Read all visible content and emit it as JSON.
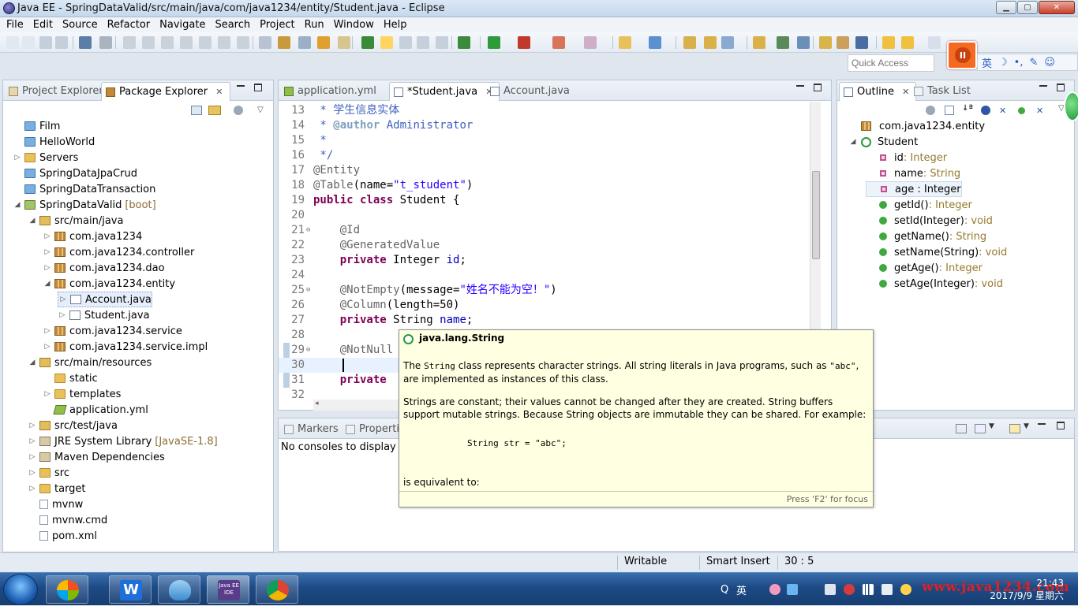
{
  "window": {
    "title": "Java EE - SpringDataValid/src/main/java/com/java1234/entity/Student.java - Eclipse",
    "min_glyph": "▁",
    "max_glyph": "▢",
    "close_glyph": "✕"
  },
  "menu": [
    "File",
    "Edit",
    "Source",
    "Refactor",
    "Navigate",
    "Search",
    "Project",
    "Run",
    "Window",
    "Help"
  ],
  "toolbar": {
    "quick_access_placeholder": "Quick Access",
    "ime_bar": [
      "英",
      "☽",
      "•,",
      "✎",
      "☺"
    ],
    "pause_glyph": "II"
  },
  "package_explorer": {
    "tabs": [
      "Project Explorer",
      "Package Explorer"
    ],
    "close_glyph": "✕",
    "tree": [
      {
        "label": "Film",
        "icon": "project",
        "arrow": "",
        "indent": 0
      },
      {
        "label": "HelloWorld",
        "icon": "project",
        "arrow": "",
        "indent": 0
      },
      {
        "label": "Servers",
        "icon": "folder",
        "arrow": "▷",
        "indent": 0
      },
      {
        "label": "SpringDataJpaCrud",
        "icon": "project",
        "arrow": "",
        "indent": 0
      },
      {
        "label": "SpringDataTransaction",
        "icon": "project",
        "arrow": "",
        "indent": 0
      },
      {
        "label": "SpringDataValid",
        "icon": "project-open",
        "arrow": "◢",
        "indent": 0,
        "decor": "[boot]"
      },
      {
        "label": "src/main/java",
        "icon": "srcfolder",
        "arrow": "◢",
        "indent": 1
      },
      {
        "label": "com.java1234",
        "icon": "package",
        "arrow": "▷",
        "indent": 2
      },
      {
        "label": "com.java1234.controller",
        "icon": "package",
        "arrow": "▷",
        "indent": 2
      },
      {
        "label": "com.java1234.dao",
        "icon": "package",
        "arrow": "▷",
        "indent": 2
      },
      {
        "label": "com.java1234.entity",
        "icon": "package",
        "arrow": "◢",
        "indent": 2
      },
      {
        "label": "Account.java",
        "icon": "java",
        "arrow": "▷",
        "indent": 3,
        "selected": true
      },
      {
        "label": "Student.java",
        "icon": "java",
        "arrow": "▷",
        "indent": 3
      },
      {
        "label": "com.java1234.service",
        "icon": "package",
        "arrow": "▷",
        "indent": 2
      },
      {
        "label": "com.java1234.service.impl",
        "icon": "package",
        "arrow": "▷",
        "indent": 2
      },
      {
        "label": "src/main/resources",
        "icon": "srcfolder",
        "arrow": "◢",
        "indent": 1
      },
      {
        "label": "static",
        "icon": "folder",
        "arrow": "",
        "indent": 2
      },
      {
        "label": "templates",
        "icon": "folder",
        "arrow": "▷",
        "indent": 2
      },
      {
        "label": "application.yml",
        "icon": "yml",
        "arrow": "",
        "indent": 2
      },
      {
        "label": "src/test/java",
        "icon": "srcfolder",
        "arrow": "▷",
        "indent": 1
      },
      {
        "label": "JRE System Library",
        "icon": "lib",
        "arrow": "▷",
        "indent": 1,
        "decor": "[JavaSE-1.8]"
      },
      {
        "label": "Maven Dependencies",
        "icon": "lib",
        "arrow": "▷",
        "indent": 1
      },
      {
        "label": "src",
        "icon": "folder",
        "arrow": "▷",
        "indent": 1
      },
      {
        "label": "target",
        "icon": "folder",
        "arrow": "▷",
        "indent": 1
      },
      {
        "label": "mvnw",
        "icon": "file",
        "arrow": "",
        "indent": 1
      },
      {
        "label": "mvnw.cmd",
        "icon": "file",
        "arrow": "",
        "indent": 1
      },
      {
        "label": "pom.xml",
        "icon": "xml",
        "arrow": "",
        "indent": 1
      }
    ]
  },
  "editor": {
    "tabs": [
      {
        "label": "application.yml",
        "active": false
      },
      {
        "label": "*Student.java",
        "active": true
      },
      {
        "label": "Account.java",
        "active": false
      }
    ],
    "close_glyph": "✕",
    "lines": [
      {
        "n": "13",
        "html": "<span class=\"cmt\"> * 学生信息实体</span>"
      },
      {
        "n": "14",
        "html": "<span class=\"cmt\"> * <span class=\"cmt-tag\">@author</span> Administrator</span>"
      },
      {
        "n": "15",
        "html": "<span class=\"cmt\"> *</span>"
      },
      {
        "n": "16",
        "html": "<span class=\"cmt\"> */</span>"
      },
      {
        "n": "17",
        "html": "<span class=\"ann\">@Entity</span>"
      },
      {
        "n": "18",
        "html": "<span class=\"ann\">@Table</span>(name=<span class=\"str\">\"t_student\"</span>)"
      },
      {
        "n": "19",
        "html": "<span class=\"kw\">public class</span> Student {"
      },
      {
        "n": "20",
        "html": ""
      },
      {
        "n": "21",
        "html": "    <span class=\"ann\">@Id</span>",
        "fold": true
      },
      {
        "n": "22",
        "html": "    <span class=\"ann\">@GeneratedValue</span>"
      },
      {
        "n": "23",
        "html": "    <span class=\"kw\">private</span> Integer <span class=\"fld\">id</span>;"
      },
      {
        "n": "24",
        "html": ""
      },
      {
        "n": "25",
        "html": "    <span class=\"ann\">@NotEmpty</span>(message=<span class=\"str\">\"姓名不能为空！\"</span>)",
        "fold": true
      },
      {
        "n": "26",
        "html": "    <span class=\"ann\">@Column</span>(length=50)"
      },
      {
        "n": "27",
        "html": "    <span class=\"kw\">private</span> String <span class=\"fld\">name</span>;"
      },
      {
        "n": "28",
        "html": ""
      },
      {
        "n": "29",
        "html": "    <span class=\"ann\">@NotNull</span>",
        "fold": true,
        "marked": true
      },
      {
        "n": "30",
        "html": "    ",
        "current": true,
        "marked": true
      },
      {
        "n": "31",
        "html": "    <span class=\"kw\">private</span>",
        "marked": true
      },
      {
        "n": "32",
        "html": ""
      }
    ]
  },
  "tooltip": {
    "title": "java.lang.String",
    "p1": "The <code>String</code> class represents character strings. All string literals in Java programs, such as <code>\"abc\"</code>, are implemented as instances of this class.",
    "p2": "Strings are constant; their values cannot be changed after they are created. String buffers support mutable strings. Because String objects are immutable they can be shared. For example:",
    "code": "String str = \"abc\";",
    "p3": "is equivalent to:",
    "footer": "Press 'F2' for focus"
  },
  "bottom_panel": {
    "tabs": [
      "Markers",
      "Properti"
    ],
    "console_text": "No consoles to display at"
  },
  "outline": {
    "tabs": [
      "Outline",
      "Task List"
    ],
    "close_glyph": "✕",
    "items": [
      {
        "name": "com.java1234.entity",
        "type": "",
        "kind": "pkg",
        "indent": 0,
        "arrow": ""
      },
      {
        "name": "Student",
        "type": "",
        "kind": "class",
        "indent": 0,
        "arrow": "◢"
      },
      {
        "name": "id",
        "type": " : Integer",
        "kind": "field",
        "indent": 1,
        "arrow": ""
      },
      {
        "name": "name",
        "type": " : String",
        "kind": "field",
        "indent": 1,
        "arrow": ""
      },
      {
        "name": "age : Integer",
        "type": "",
        "kind": "field",
        "indent": 1,
        "arrow": "",
        "selected": true
      },
      {
        "name": "getId()",
        "type": " : Integer",
        "kind": "method",
        "indent": 1,
        "arrow": ""
      },
      {
        "name": "setId(Integer)",
        "type": " : void",
        "kind": "method",
        "indent": 1,
        "arrow": ""
      },
      {
        "name": "getName()",
        "type": " : String",
        "kind": "method",
        "indent": 1,
        "arrow": ""
      },
      {
        "name": "setName(String)",
        "type": " : void",
        "kind": "method",
        "indent": 1,
        "arrow": ""
      },
      {
        "name": "getAge()",
        "type": " : Integer",
        "kind": "method",
        "indent": 1,
        "arrow": ""
      },
      {
        "name": "setAge(Integer)",
        "type": " : void",
        "kind": "method",
        "indent": 1,
        "arrow": ""
      }
    ]
  },
  "status": {
    "writable": "Writable",
    "insert_mode": "Smart Insert",
    "position": "30 : 5"
  },
  "taskbar": {
    "ime": "英",
    "time": "21:43",
    "date": "2017/9/9 星期六",
    "watermark": "www.java1234.com",
    "javaee_label": "Java EE IDE"
  }
}
